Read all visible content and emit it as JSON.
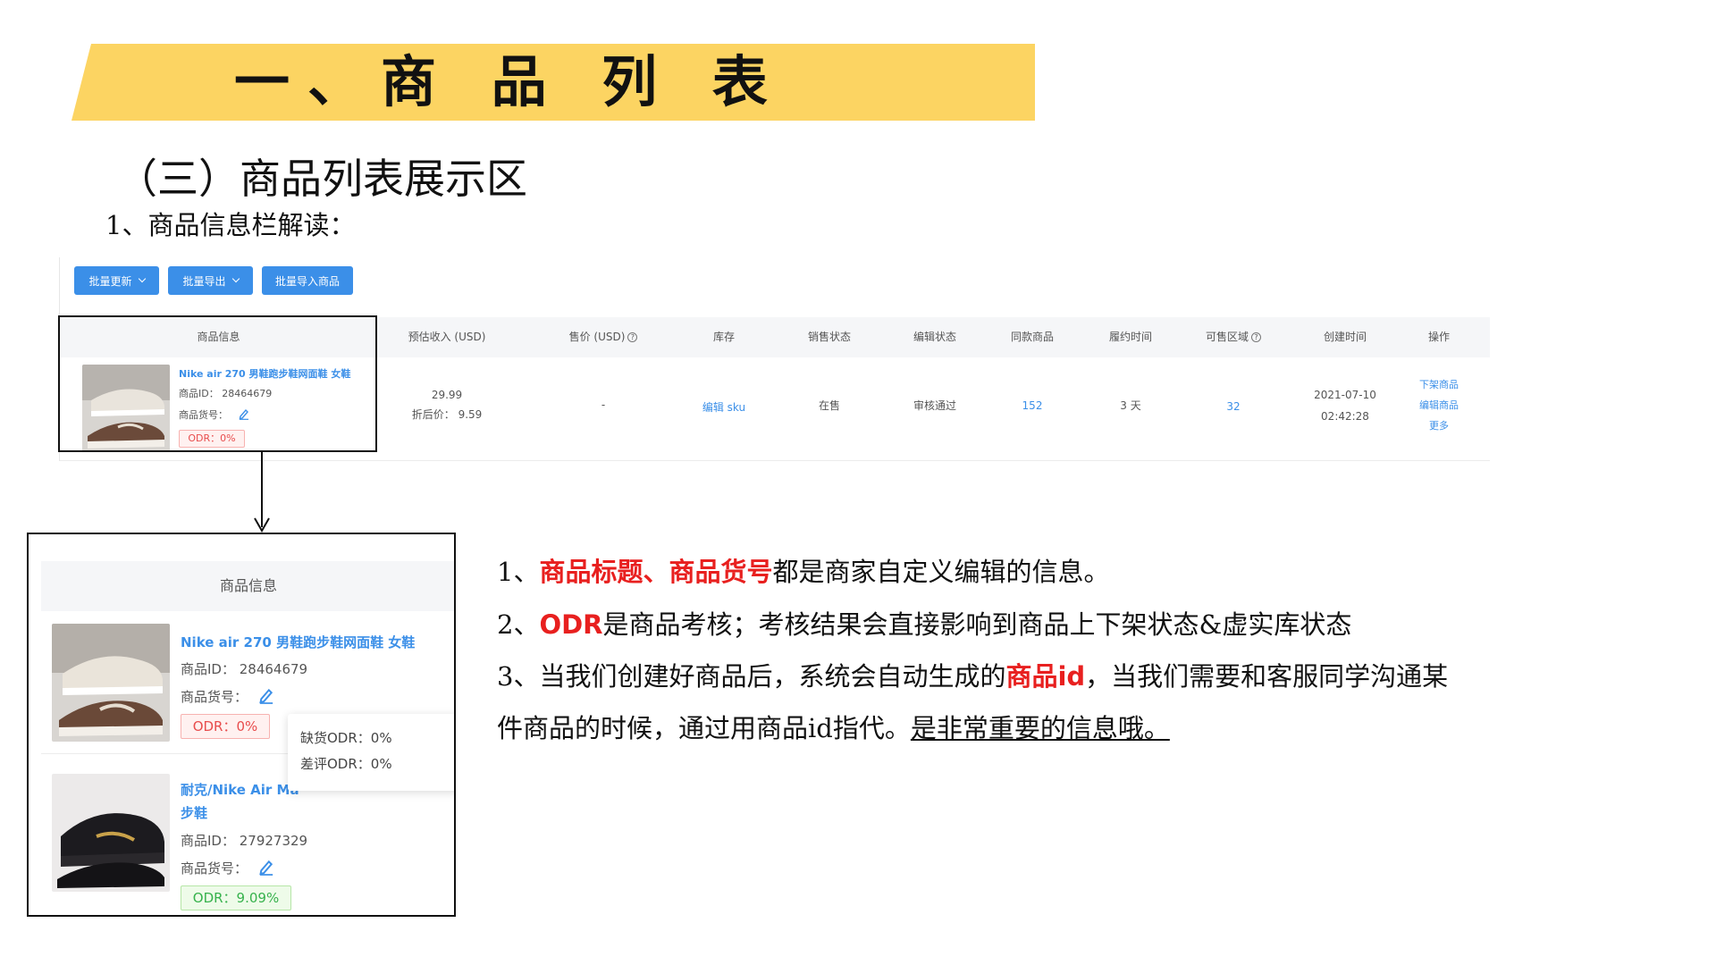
{
  "banner": {
    "title": "一、商 品 列 表"
  },
  "section_title": "（三）商品列表展示区",
  "sub_title": "1、商品信息栏解读：",
  "toolbar": {
    "batch_update": "批量更新",
    "batch_export": "批量导出",
    "batch_import": "批量导入商品"
  },
  "table": {
    "headers": {
      "product_info": "商品信息",
      "est_income": "预估收入 (USD)",
      "price": "售价 (USD)",
      "stock": "库存",
      "sale_status": "销售状态",
      "edit_status": "编辑状态",
      "same_products": "同款商品",
      "fulfil_time": "履约时间",
      "sale_region": "可售区域",
      "created_time": "创建时间",
      "actions": "操作"
    },
    "row": {
      "title": "Nike air 270 男鞋跑步鞋网面鞋 女鞋",
      "product_id_label": "商品ID：",
      "product_id": "28464679",
      "sku_code_label": "商品货号：",
      "odr": "ODR：0%",
      "income": "29.99",
      "discount_label": "折后价：",
      "discount_value": "9.59",
      "price": "-",
      "stock": "编辑 sku",
      "sale_status": "在售",
      "edit_status": "审核通过",
      "same_products": "152",
      "fulfil_time": "3 天",
      "sale_region": "32",
      "created_date": "2021-07-10",
      "created_time": "02:42:28",
      "action_delist": "下架商品",
      "action_edit": "编辑商品",
      "action_more": "更多"
    }
  },
  "zoom": {
    "header": "商品信息",
    "item1": {
      "title": "Nike air 270 男鞋跑步鞋网面鞋 女鞋",
      "id_line": "商品ID：  28464679",
      "sku_label": "商品货号：",
      "odr": "ODR：0%"
    },
    "tooltip": {
      "line1": "缺货ODR：0%",
      "line2": "差评ODR：0%"
    },
    "item2": {
      "title_line1": "耐克/Nike Air Ma",
      "title_line2": "步鞋",
      "id_line": "商品ID：  27927329",
      "sku_label": "商品货号：",
      "odr": "ODR：9.09%"
    }
  },
  "explain": {
    "p1_prefix": "1、",
    "p1_red": "商品标题、商品货号",
    "p1_suffix": "都是商家自定义编辑的信息。",
    "p2_prefix": "2、",
    "p2_red": "ODR",
    "p2_suffix": "是商品考核；考核结果会直接影响到商品上下架状态&虚实库状态",
    "p3_prefix": "3、当我们创建好商品后，系统会自动生成的",
    "p3_red": "商品id",
    "p3_suffix": "，当我们需要和客服同学沟通某",
    "p4_text": "件商品的时候，通过用商品id指代。",
    "p4_ul": "是非常重要的信息哦。"
  },
  "colors": {
    "banner": "#FCD462",
    "link": "#3b8fe8",
    "emphasis": "#e8201f",
    "odr_red": "#e84d4d",
    "odr_green": "#37b24d"
  }
}
